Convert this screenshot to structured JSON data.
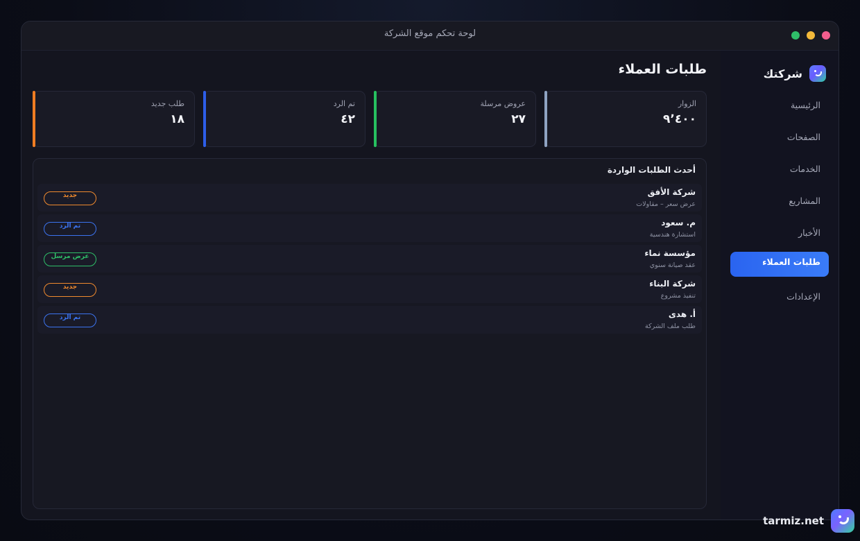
{
  "window": {
    "title": "لوحة تحكم موقع الشركة"
  },
  "brand": {
    "name": "شركتك",
    "icon": "smile-logo-icon"
  },
  "sidebar": {
    "items": [
      {
        "label": "الرئيسية",
        "active": false
      },
      {
        "label": "الصفحات",
        "active": false
      },
      {
        "label": "الخدمات",
        "active": false
      },
      {
        "label": "المشاريع",
        "active": false
      },
      {
        "label": "الأخبار",
        "active": false
      },
      {
        "label": "طلبات العملاء",
        "active": true
      },
      {
        "label": "الإعدادات",
        "active": false
      }
    ]
  },
  "main": {
    "title": "طلبات العملاء",
    "stats": [
      {
        "label": "الزوار",
        "value": "٩٬٤٠٠",
        "color": "#8fa3c2"
      },
      {
        "label": "عروض مرسلة",
        "value": "٢٧",
        "color": "#26c05f"
      },
      {
        "label": "تم الرد",
        "value": "٤٢",
        "color": "#2d5ee8"
      },
      {
        "label": "طلب جديد",
        "value": "١٨",
        "color": "#f07d22"
      }
    ],
    "requests": {
      "title": "أحدث الطلبات الواردة",
      "rows": [
        {
          "name": "شركة الأفق",
          "sub": "عرض سعر – مقاولات",
          "status": "جديد",
          "status_color": "#f08a2e"
        },
        {
          "name": "م. سعود",
          "sub": "استشارة هندسية",
          "status": "تم الرد",
          "status_color": "#3c74f0"
        },
        {
          "name": "مؤسسة نماء",
          "sub": "عقد صيانة سنوي",
          "status": "عرض مرسل",
          "status_color": "#2fbf68"
        },
        {
          "name": "شركة البناء",
          "sub": "تنفيذ مشروع",
          "status": "جديد",
          "status_color": "#f08a2e"
        },
        {
          "name": "أ. هدى",
          "sub": "طلب ملف الشركة",
          "status": "تم الرد",
          "status_color": "#3c74f0"
        }
      ]
    }
  },
  "footer": {
    "site": "tarmiz.net",
    "icon": "smile-logo-icon"
  }
}
